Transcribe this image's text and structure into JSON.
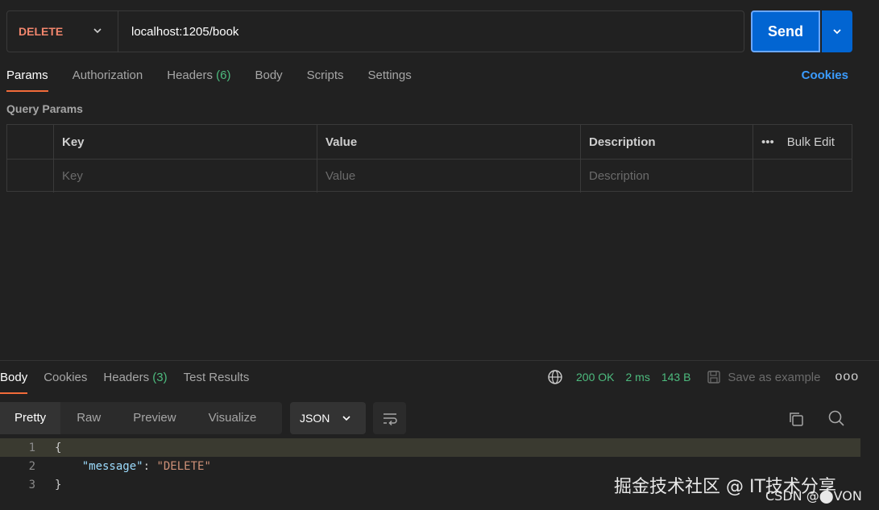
{
  "request": {
    "method": "DELETE",
    "url": "localhost:1205/book",
    "send_label": "Send"
  },
  "request_tabs": {
    "params": "Params",
    "authorization": "Authorization",
    "headers": "Headers",
    "headers_count": "(6)",
    "body": "Body",
    "scripts": "Scripts",
    "settings": "Settings",
    "cookies": "Cookies"
  },
  "query_params": {
    "title": "Query Params",
    "columns": {
      "key": "Key",
      "value": "Value",
      "description": "Description",
      "bulk_edit": "Bulk Edit"
    },
    "placeholders": {
      "key": "Key",
      "value": "Value",
      "description": "Description"
    }
  },
  "response_tabs": {
    "body": "Body",
    "cookies": "Cookies",
    "headers": "Headers",
    "headers_count": "(3)",
    "test_results": "Test Results"
  },
  "response_meta": {
    "status": "200 OK",
    "time": "2 ms",
    "size": "143 B",
    "save_example": "Save as example"
  },
  "view_modes": {
    "pretty": "Pretty",
    "raw": "Raw",
    "preview": "Preview",
    "visualize": "Visualize"
  },
  "format": "JSON",
  "code": {
    "lines": [
      "1",
      "2",
      "3"
    ],
    "open_brace": "{",
    "key": "\"message\"",
    "colon": ": ",
    "value": "\"DELETE\"",
    "close_brace": "}"
  },
  "watermark": {
    "line1": "掘金技术社区 @ IT技术分享",
    "line2": "CSDN @⬤VON"
  },
  "colors": {
    "method": "#f2866d",
    "send": "#0265d2",
    "status_ok": "#4dbb7e",
    "accent_tab": "#f26b3a",
    "link": "#3b9cff"
  }
}
